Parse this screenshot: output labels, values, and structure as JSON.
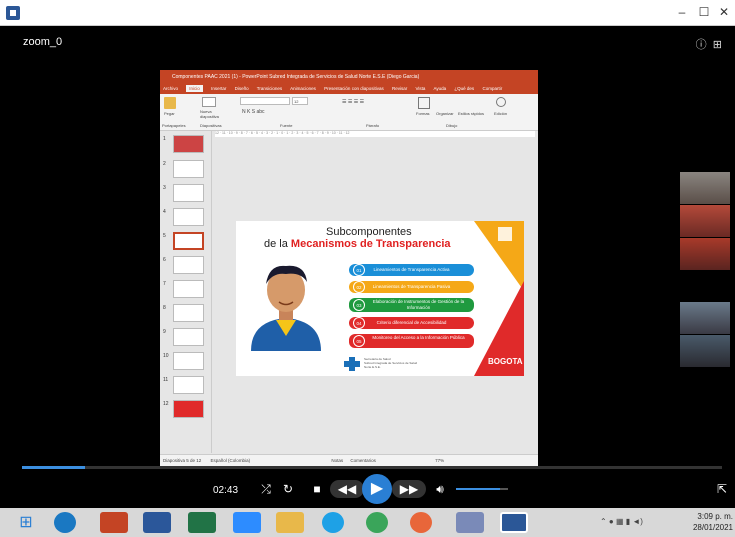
{
  "window": {
    "minimize": "–",
    "maximize": "☐",
    "close": "✕"
  },
  "meeting": {
    "title": "zoom_0"
  },
  "ppt": {
    "title": "Componentes PAAC 2021 (1) - PowerPoint   Subred Integrada de Servicios de Salud Norte E.S.E (Diego Garcia)",
    "tabs": [
      "Archivo",
      "Inicio",
      "Insertar",
      "Diseño",
      "Transiciones",
      "Animaciones",
      "Presentación con diapositivas",
      "Revisar",
      "Vista",
      "Ayuda",
      "¿Qué des",
      "Compartir"
    ],
    "ribbon_groups": [
      "Portapapeles",
      "Diapositivas",
      "Fuente",
      "Párrafo",
      "Dibujo"
    ],
    "ribbon_buttons": {
      "paste": "Pegar",
      "new_slide": "Nueva diapositiva",
      "shapes": "Formas",
      "arrange": "Organizar",
      "quick_styles": "Estilos rápidos",
      "edit": "Edición"
    },
    "font_size": "12",
    "ruler": "12 · 11 · 10 · 9 · 8 · 7 · 6 · 5 · 4 · 3 · 2 · 1 · 0 · 1 · 2 · 3 · 4 · 5 · 6 · 7 · 8 · 9 · 10 · 11 · 12",
    "thumbnails": [
      "1",
      "2",
      "3",
      "4",
      "5",
      "6",
      "7",
      "8",
      "9",
      "10",
      "11",
      "12"
    ],
    "status": {
      "slide_info": "Diapositiva 5 de 12",
      "language": "Español (Colombia)",
      "notes": "Notas",
      "comments": "Comentarios",
      "zoom": "77%"
    }
  },
  "slide": {
    "title_line1": "Subcomponentes",
    "title_line2_prefix": "de la",
    "title_line2_highlight": "Mecanismos de Transparencia",
    "items": [
      {
        "num": "01",
        "text": "Lineamientos de Transparencia Activa",
        "color": "#1a8fd8"
      },
      {
        "num": "02",
        "text": "Lineamientos de Transparencia Pasiva",
        "color": "#f5a817"
      },
      {
        "num": "03",
        "text": "Elaboración de Instrumentos de Gestión de la Información",
        "color": "#1f9a3f"
      },
      {
        "num": "04",
        "text": "Criterio diferencial de Accesibilidad",
        "color": "#e02a2a"
      },
      {
        "num": "05",
        "text": "Monitoreo del Acceso a la Información Pública",
        "color": "#e02a2a"
      }
    ],
    "footer_org": "Secretaría de Salud\nSubred Integrada de Servicios de Salud\nNorte E.S.E.",
    "brand": "BOGOTA"
  },
  "player": {
    "time": "02:43",
    "progress": 0.09,
    "volume": 0.85
  },
  "taskbar": {
    "clock_time": "3:09 p. m.",
    "clock_date": "28/01/2021"
  },
  "colors": {
    "ppt_accent": "#c44424",
    "player_accent": "#3c8fe0"
  }
}
